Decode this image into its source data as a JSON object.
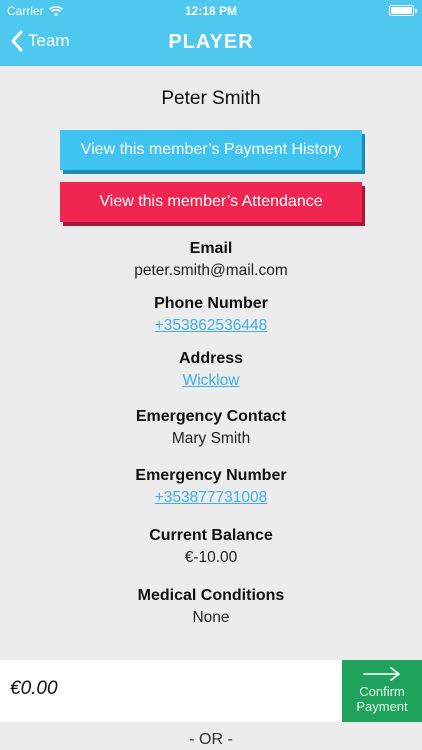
{
  "status_bar": {
    "carrier": "Carrier",
    "time": "12:18 PM"
  },
  "nav": {
    "back_label": "Team",
    "title": "PLAYER"
  },
  "player": {
    "name": "Peter Smith"
  },
  "buttons": {
    "payment_history": "View this member’s Payment History",
    "attendance": "View this member’s Attendance"
  },
  "fields": {
    "email": {
      "label": "Email",
      "value": "peter.smith@mail.com"
    },
    "phone": {
      "label": "Phone Number",
      "value": "+353862536448"
    },
    "address": {
      "label": "Address",
      "value": "Wicklow"
    },
    "emergency_contact": {
      "label": "Emergency Contact",
      "value": "Mary Smith"
    },
    "emergency_number": {
      "label": "Emergency Number",
      "value": "+353877731008"
    },
    "balance": {
      "label": "Current Balance",
      "value": "€-10.00"
    },
    "medical": {
      "label": "Medical Conditions",
      "value": "None"
    }
  },
  "payment": {
    "amount_value": "€0.00",
    "confirm_line1": "Confirm",
    "confirm_line2": "Payment",
    "or_divider": "- OR -"
  },
  "colors": {
    "nav_bg": "#4fc8ef",
    "blue_button": "#3fc3f0",
    "red_button": "#f02650",
    "confirm_green": "#1fa35c",
    "link": "#3fb0e6"
  },
  "icons": {
    "back": "chevron-left-icon",
    "wifi": "wifi-icon",
    "battery": "battery-icon",
    "confirm": "arrow-right-icon"
  }
}
